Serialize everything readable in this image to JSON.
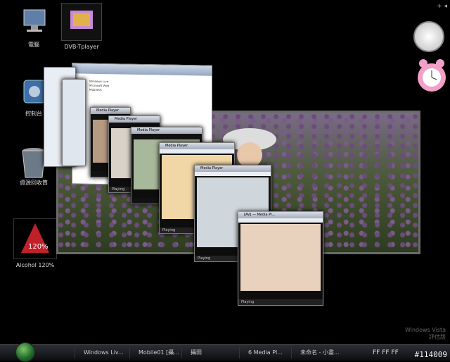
{
  "desktop": {
    "icons": [
      {
        "label": "電腦"
      },
      {
        "label": "DVB-Tplayer"
      },
      {
        "label": "控制台"
      },
      {
        "label": "資源回收筒"
      },
      {
        "label": "Alcohol 120%"
      }
    ]
  },
  "flip": {
    "ie_lines": [
      "Windows Live",
      "Microsoft Web",
      "Mobile01"
    ],
    "media_player_title": "Media Player",
    "player_status": "Playing",
    "front_title": "[AV] — Media Pl..."
  },
  "taskbar": {
    "buttons": [
      {
        "label": "Windows Liv..."
      },
      {
        "label": "Mobile01 [攝..."
      },
      {
        "label": "攝田"
      },
      {
        "label": "6 Media Pl..."
      },
      {
        "label": "未命名 - 小畫..."
      }
    ],
    "tray_text": "FF FF FF"
  },
  "sidebar_toggle": "+ ◂",
  "watermark": {
    "line1": "Windows Vista",
    "line2": "評估版"
  },
  "stamp": "#114009",
  "colors": {
    "accent": "#1f6d2a",
    "flower": "#7b5b8a"
  }
}
